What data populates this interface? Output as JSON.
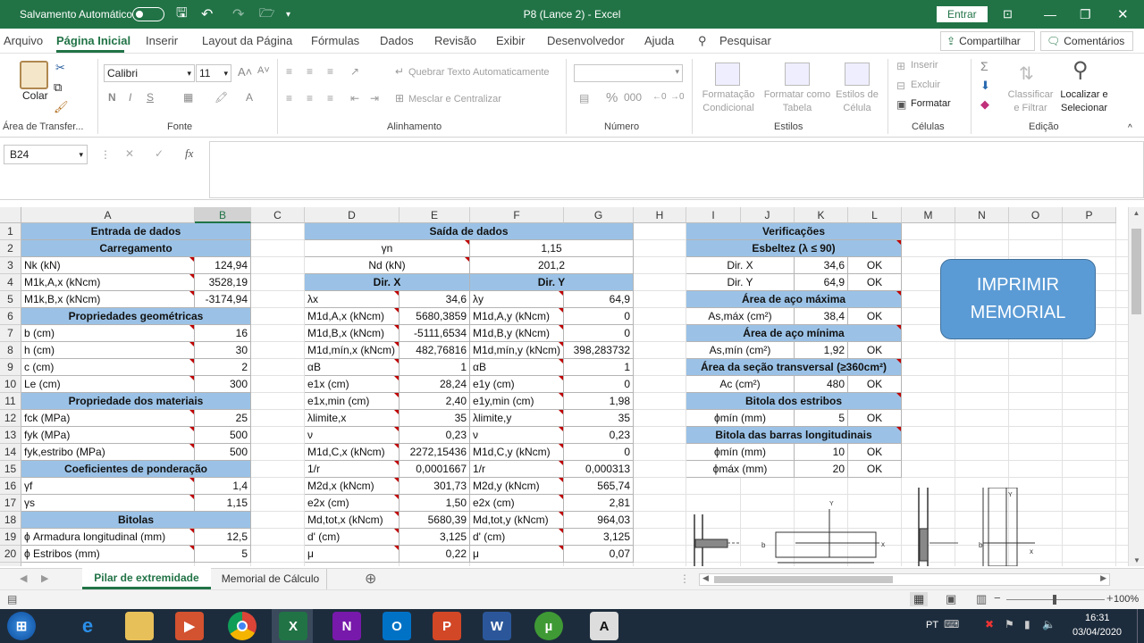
{
  "titlebar": {
    "autosave_label": "Salvamento Automático",
    "title": "P8 (Lance 2)  -  Excel",
    "signin": "Entrar"
  },
  "tabs": [
    "Arquivo",
    "Página Inicial",
    "Inserir",
    "Layout da Página",
    "Fórmulas",
    "Dados",
    "Revisão",
    "Exibir",
    "Desenvolvedor",
    "Ajuda"
  ],
  "search_label": "Pesquisar",
  "share_label": "Compartilhar",
  "comments_label": "Comentários",
  "ribbon": {
    "paste": "Colar",
    "clipboard_group": "Área de Transfer...",
    "font_name": "Calibri",
    "font_size": "11",
    "font_group": "Fonte",
    "wrap_text": "Quebrar Texto Automaticamente",
    "merge_center": "Mesclar e Centralizar",
    "align_group": "Alinhamento",
    "number_group": "Número",
    "cond_format": "Formatação Condicional",
    "format_table": "Formatar como Tabela",
    "cell_styles": "Estilos de Célula",
    "styles_group": "Estilos",
    "insert": "Inserir",
    "delete": "Excluir",
    "format": "Formatar",
    "cells_group": "Células",
    "sort_filter": "Classificar e Filtrar",
    "find_select": "Localizar e Selecionar",
    "editing_group": "Edição"
  },
  "namebox": "B24",
  "columns": [
    "A",
    "B",
    "C",
    "D",
    "E",
    "F",
    "G",
    "H",
    "I",
    "J",
    "K",
    "L",
    "M",
    "N",
    "O",
    "P"
  ],
  "rows": [
    "1",
    "2",
    "3",
    "4",
    "5",
    "6",
    "7",
    "8",
    "9",
    "10",
    "11",
    "12",
    "13",
    "14",
    "15",
    "16",
    "17",
    "18",
    "19",
    "20"
  ],
  "input": {
    "title": "Entrada de dados",
    "rows": [
      {
        "label": "Carregamento",
        "value": "",
        "header": true
      },
      {
        "label": "Nk (kN)",
        "value": "124,94"
      },
      {
        "label": "M1k,A,x (kNcm)",
        "value": "3528,19"
      },
      {
        "label": "M1k,B,x (kNcm)",
        "value": "-3174,94"
      },
      {
        "label": "Propriedades geométricas",
        "value": "",
        "header": true
      },
      {
        "label": "b (cm)",
        "value": "16"
      },
      {
        "label": "h (cm)",
        "value": "30"
      },
      {
        "label": "c (cm)",
        "value": "2"
      },
      {
        "label": "Le (cm)",
        "value": "300"
      },
      {
        "label": "Propriedade dos materiais",
        "value": "",
        "header": true
      },
      {
        "label": "fck (MPa)",
        "value": "25"
      },
      {
        "label": "fyk (MPa)",
        "value": "500"
      },
      {
        "label": "fyk,estribo (MPa)",
        "value": "500"
      },
      {
        "label": "Coeficientes de ponderação",
        "value": "",
        "header": true
      },
      {
        "label": "γf",
        "value": "1,4"
      },
      {
        "label": "γs",
        "value": "1,15"
      },
      {
        "label": "Bitolas",
        "value": "",
        "header": true
      },
      {
        "label": "ϕ Armadura longitudinal (mm)",
        "value": "12,5"
      },
      {
        "label": "ϕ Estribos (mm)",
        "value": "5"
      }
    ]
  },
  "output": {
    "title": "Saída de dados",
    "gamma_n": {
      "label": "γn",
      "value": "1,15"
    },
    "nd": {
      "label": "Nd (kN)",
      "value": "201,2"
    },
    "dir_x": "Dir. X",
    "dir_y": "Dir. Y",
    "rows": [
      {
        "lx": "λx",
        "vx": "34,6",
        "ly": "λy",
        "vy": "64,9"
      },
      {
        "lx": "M1d,A,x (kNcm)",
        "vx": "5680,3859",
        "ly": "M1d,A,y (kNcm)",
        "vy": "0"
      },
      {
        "lx": "M1d,B,x (kNcm)",
        "vx": "-5111,6534",
        "ly": "M1d,B,y (kNcm)",
        "vy": "0"
      },
      {
        "lx": "M1d,mín,x (kNcm)",
        "vx": "482,76816",
        "ly": "M1d,mín,y (kNcm)",
        "vy": "398,283732"
      },
      {
        "lx": "αB",
        "vx": "1",
        "ly": "αB",
        "vy": "1"
      },
      {
        "lx": "e1x (cm)",
        "vx": "28,24",
        "ly": "e1y (cm)",
        "vy": "0"
      },
      {
        "lx": "e1x,min (cm)",
        "vx": "2,40",
        "ly": "e1y,min (cm)",
        "vy": "1,98"
      },
      {
        "lx": "λlimite,x",
        "vx": "35",
        "ly": "λlimite,y",
        "vy": "35"
      },
      {
        "lx": "ν",
        "vx": "0,23",
        "ly": "ν",
        "vy": "0,23"
      },
      {
        "lx": "M1d,C,x (kNcm)",
        "vx": "2272,15436",
        "ly": "M1d,C,y (kNcm)",
        "vy": "0"
      },
      {
        "lx": "1/r",
        "vx": "0,0001667",
        "ly": "1/r",
        "vy": "0,000313"
      },
      {
        "lx": "M2d,x (kNcm)",
        "vx": "301,73",
        "ly": "M2d,y (kNcm)",
        "vy": "565,74"
      },
      {
        "lx": "e2x (cm)",
        "vx": "1,50",
        "ly": "e2x (cm)",
        "vy": "2,81"
      },
      {
        "lx": "Md,tot,x (kNcm)",
        "vx": "5680,39",
        "ly": "Md,tot,y (kNcm)",
        "vy": "964,03"
      },
      {
        "lx": "d' (cm)",
        "vx": "3,125",
        "ly": "d' (cm)",
        "vy": "3,125"
      },
      {
        "lx": "μ",
        "vx": "0,22",
        "ly": "μ",
        "vy": "0,07"
      }
    ]
  },
  "checks": {
    "title": "Verificações",
    "rows": [
      {
        "label": "Esbeltez (λ ≤ 90)",
        "header": true
      },
      {
        "label": "Dir. X",
        "value": "34,6",
        "status": "OK"
      },
      {
        "label": "Dir. Y",
        "value": "64,9",
        "status": "OK"
      },
      {
        "label": "Área de aço máxima",
        "header": true
      },
      {
        "label": "As,máx (cm²)",
        "value": "38,4",
        "status": "OK"
      },
      {
        "label": "Área de aço mínima",
        "header": true
      },
      {
        "label": "As,mín (cm²)",
        "value": "1,92",
        "status": "OK"
      },
      {
        "label": "Área da seção transversal (≥360cm²)",
        "header": true
      },
      {
        "label": "Ac (cm²)",
        "value": "480",
        "status": "OK"
      },
      {
        "label": "Bitola dos estribos",
        "header": true
      },
      {
        "label": "ϕmín (mm)",
        "value": "5",
        "status": "OK"
      },
      {
        "label": "Bitola das barras longitudinais",
        "header": true
      },
      {
        "label": "ϕmín (mm)",
        "value": "10",
        "status": "OK"
      },
      {
        "label": "ϕmáx (mm)",
        "value": "20",
        "status": "OK"
      }
    ]
  },
  "print_button": {
    "line1": "IMPRIMIR",
    "line2": "MEMORIAL"
  },
  "diagram": {
    "b": "b",
    "x": "x",
    "y": "Y"
  },
  "sheets": [
    {
      "name": "Pilar de extremidade",
      "active": true
    },
    {
      "name": "Memorial de Cálculo",
      "active": false
    }
  ],
  "status": {
    "zoom": "100%"
  },
  "taskbar": {
    "lang": "PT",
    "time": "16:31",
    "date": "03/04/2020"
  },
  "colors": {
    "excel_green": "#217346",
    "header_blue": "#9bc2e6",
    "button_blue": "#5b9bd5"
  }
}
